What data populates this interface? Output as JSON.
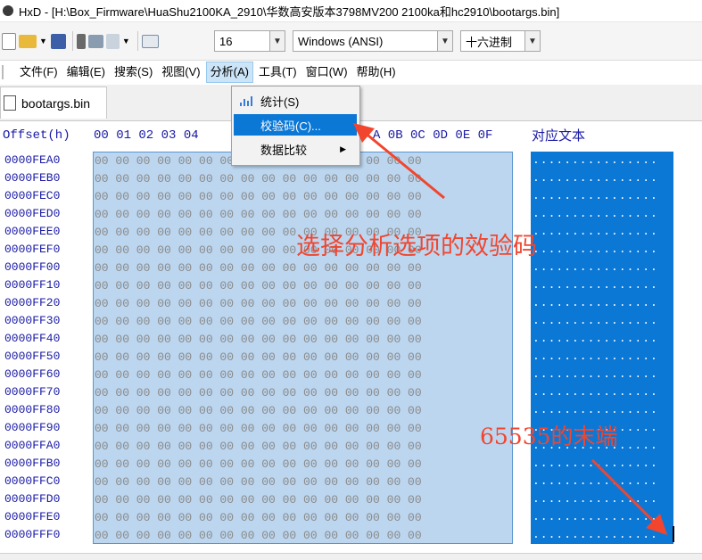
{
  "window": {
    "title": "HxD - [H:\\Box_Firmware\\HuaShu2100KA_2910\\华数高安版本3798MV200 2100ka和hc2910\\bootargs.bin]"
  },
  "toolbar": {
    "bytes_per_row": "16",
    "charset": "Windows (ANSI)",
    "offset_base": "十六进制"
  },
  "menu": {
    "items": [
      "文件(F)",
      "编辑(E)",
      "搜索(S)",
      "视图(V)",
      "分析(A)",
      "工具(T)",
      "窗口(W)",
      "帮助(H)"
    ],
    "active": "分析(A)"
  },
  "tab": {
    "label": "bootargs.bin"
  },
  "analysis_menu": {
    "items": [
      "统计(S)",
      "校验码(C)...",
      "数据比较"
    ],
    "highlighted": "校验码(C)..."
  },
  "editor": {
    "offset_header": "Offset(h)",
    "hex_header": "00 01 02 03 04",
    "hex_header_tail": "A 0B 0C 0D 0E 0F",
    "text_header": "对应文本",
    "offsets": [
      "0000FEA0",
      "0000FEB0",
      "0000FEC0",
      "0000FED0",
      "0000FEE0",
      "0000FEF0",
      "0000FF00",
      "0000FF10",
      "0000FF20",
      "0000FF30",
      "0000FF40",
      "0000FF50",
      "0000FF60",
      "0000FF70",
      "0000FF80",
      "0000FF90",
      "0000FFA0",
      "0000FFB0",
      "0000FFC0",
      "0000FFD0",
      "0000FFE0",
      "0000FFF0"
    ],
    "hex_row": "00 00 00 00 00 00 00 00 00 00 00 00 00 00 00 00",
    "text_row": "................"
  },
  "annotations": {
    "select_checksum": "选择分析选项的效验码",
    "end_of_65535": "65535的末端"
  },
  "colors": {
    "selection_hex": "#bcd6ef",
    "selection_text": "#0c78d6",
    "offset_text": "#1a1aa6",
    "annotation": "#f2452e",
    "menu_highlight": "#0c78d6"
  }
}
